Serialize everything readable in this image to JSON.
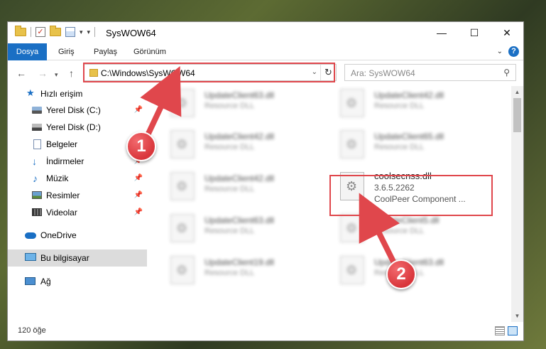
{
  "window": {
    "title": "SysWOW64",
    "controls": {
      "minimize": "—",
      "maximize": "☐",
      "close": "✕"
    }
  },
  "ribbon": {
    "tabs": [
      "Dosya",
      "Giriş",
      "Paylaş",
      "Görünüm"
    ],
    "help": "?"
  },
  "navigation": {
    "back": "←",
    "forward": "→",
    "up": "↑",
    "address": "C:\\Windows\\SysWOW64",
    "refresh": "↻",
    "search_placeholder": "Ara: SysWOW64"
  },
  "sidebar": {
    "items": [
      {
        "label": "Hızlı erişim",
        "icon": "star-icon",
        "pinned": false
      },
      {
        "label": "Yerel Disk (C:)",
        "icon": "drive-icon",
        "pinned": true
      },
      {
        "label": "Yerel Disk (D:)",
        "icon": "drive-icon",
        "pinned": false
      },
      {
        "label": "Belgeler",
        "icon": "document-icon",
        "pinned": true
      },
      {
        "label": "İndirmeler",
        "icon": "download-icon",
        "pinned": true
      },
      {
        "label": "Müzik",
        "icon": "music-icon",
        "pinned": true
      },
      {
        "label": "Resimler",
        "icon": "pictures-icon",
        "pinned": true
      },
      {
        "label": "Videolar",
        "icon": "videos-icon",
        "pinned": true
      },
      {
        "label": "OneDrive",
        "icon": "cloud-icon",
        "pinned": false
      },
      {
        "label": "Bu bilgisayar",
        "icon": "computer-icon",
        "pinned": false,
        "selected": true
      },
      {
        "label": "Ağ",
        "icon": "network-icon",
        "pinned": false
      }
    ]
  },
  "files": [
    {
      "name": "UpdateClient63.dll",
      "desc": "Resource DLL"
    },
    {
      "name": "UpdateClient42.dll",
      "desc": "Resource DLL"
    },
    {
      "name": "UpdateClient42.dll",
      "desc": "Resource DLL"
    },
    {
      "name": "UpdateClient65.dll",
      "desc": "Resource DLL"
    },
    {
      "name": "UpdateClient42.dll",
      "desc": "Resource DLL"
    },
    {
      "name": "coolsecnss.dll",
      "version": "3.6.5.2262",
      "desc": "CoolPeer Component ..."
    },
    {
      "name": "UpdateClient63.dll",
      "desc": "Resource DLL"
    },
    {
      "name": "UpdateClient5.dll",
      "desc": "Resource DLL"
    },
    {
      "name": "UpdateClient19.dll",
      "desc": "Resource DLL"
    },
    {
      "name": "UpdateClient63.dll",
      "desc": "Resource DLL"
    }
  ],
  "status": {
    "count": "120 öğe"
  },
  "annotations": {
    "callout1": "1",
    "callout2": "2"
  },
  "colors": {
    "accent": "#1a6fc4",
    "highlight": "#e0474c"
  }
}
